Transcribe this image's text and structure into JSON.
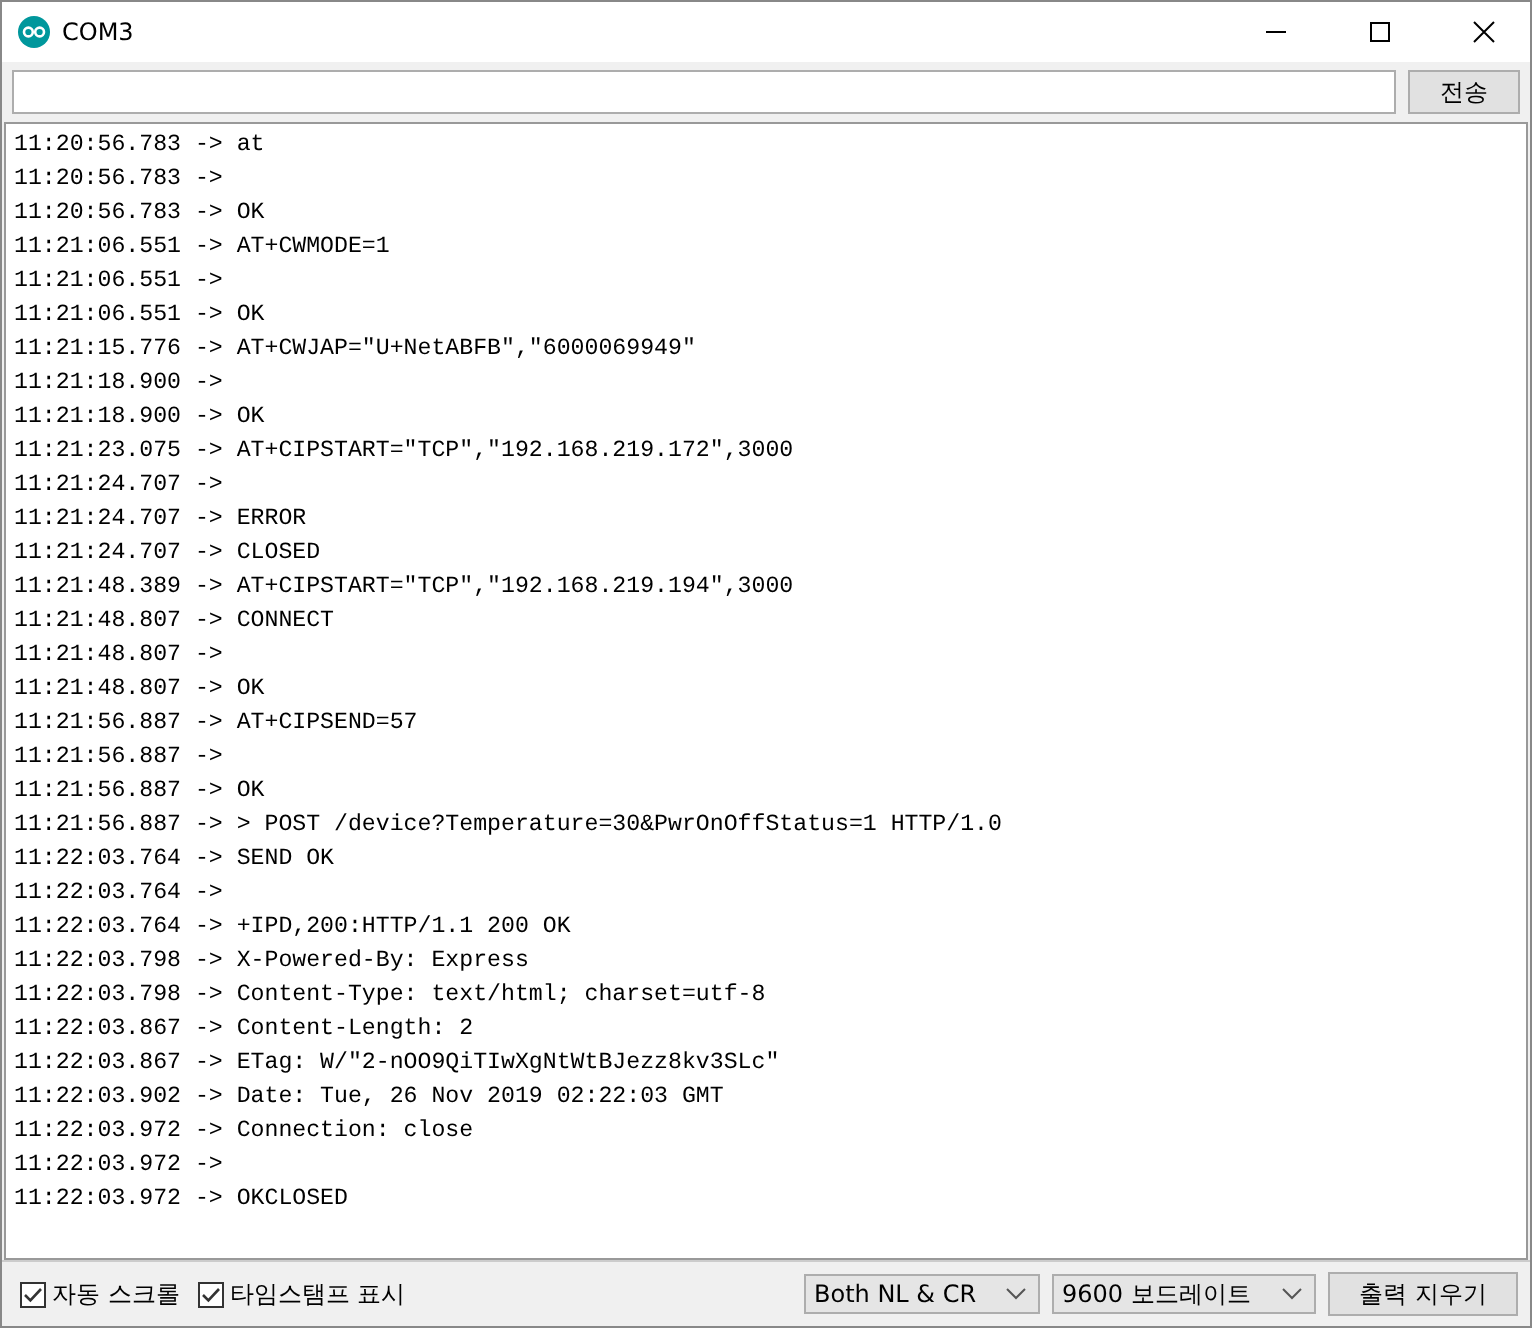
{
  "window": {
    "title": "COM3"
  },
  "send_button": "전송",
  "log": [
    "11:20:56.783 -> at",
    "11:20:56.783 -> ",
    "11:20:56.783 -> OK",
    "11:21:06.551 -> AT+CWMODE=1",
    "11:21:06.551 -> ",
    "11:21:06.551 -> OK",
    "11:21:15.776 -> AT+CWJAP=\"U+NetABFB\",\"6000069949\"",
    "11:21:18.900 -> ",
    "11:21:18.900 -> OK",
    "11:21:23.075 -> AT+CIPSTART=\"TCP\",\"192.168.219.172\",3000",
    "11:21:24.707 -> ",
    "11:21:24.707 -> ERROR",
    "11:21:24.707 -> CLOSED",
    "11:21:48.389 -> AT+CIPSTART=\"TCP\",\"192.168.219.194\",3000",
    "11:21:48.807 -> CONNECT",
    "11:21:48.807 -> ",
    "11:21:48.807 -> OK",
    "11:21:56.887 -> AT+CIPSEND=57",
    "11:21:56.887 -> ",
    "11:21:56.887 -> OK",
    "11:21:56.887 -> > POST /device?Temperature=30&PwrOnOffStatus=1 HTTP/1.0",
    "11:22:03.764 -> SEND OK",
    "11:22:03.764 -> ",
    "11:22:03.764 -> +IPD,200:HTTP/1.1 200 OK",
    "11:22:03.798 -> X-Powered-By: Express",
    "11:22:03.798 -> Content-Type: text/html; charset=utf-8",
    "11:22:03.867 -> Content-Length: 2",
    "11:22:03.867 -> ETag: W/\"2-nOO9QiTIwXgNtWtBJezz8kv3SLc\"",
    "11:22:03.902 -> Date: Tue, 26 Nov 2019 02:22:03 GMT",
    "11:22:03.972 -> Connection: close",
    "11:22:03.972 -> ",
    "11:22:03.972 -> OKCLOSED"
  ],
  "options": [
    {
      "label": "자동 스크롤",
      "checked": true
    },
    {
      "label": "타임스탬프 표시",
      "checked": true
    }
  ],
  "line_ending": "Both NL & CR",
  "baud_rate": "9600 보드레이트",
  "clear_button": "출력 지우기"
}
